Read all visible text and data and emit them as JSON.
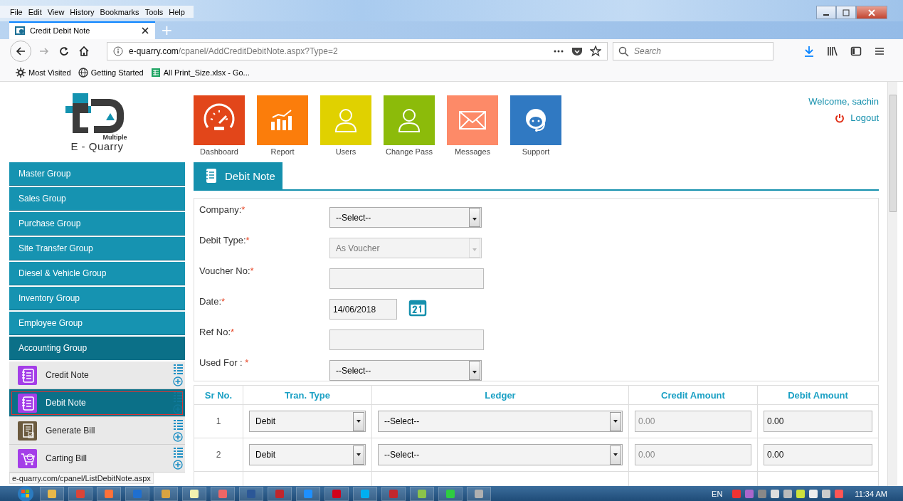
{
  "browser": {
    "menu": [
      "File",
      "Edit",
      "View",
      "History",
      "Bookmarks",
      "Tools",
      "Help"
    ],
    "tab": {
      "title": "Credit Debit Note",
      "selected": true
    },
    "new_tab": "+",
    "url": {
      "domain": "e-quarry.com",
      "path": "/cpanel/AddCreditDebitNote.aspx?Type=2"
    },
    "search": {
      "placeholder": "Search"
    },
    "bookmarks": [
      "Most Visited",
      "Getting Started",
      "All Print_Size.xlsx - Go..."
    ]
  },
  "header": {
    "logo": {
      "subtitle": "Multiple",
      "name": "E - Quarry"
    },
    "tiles": [
      {
        "label": "Dashboard",
        "color": "#e2461a"
      },
      {
        "label": "Report",
        "color": "#fb7d0b"
      },
      {
        "label": "Users",
        "color": "#e0d100"
      },
      {
        "label": "Change Pass",
        "color": "#8cbb0a"
      },
      {
        "label": "Messages",
        "color": "#fd8a68"
      },
      {
        "label": "Support",
        "color": "#3079c2"
      }
    ],
    "welcome": "Welcome, sachin",
    "logout": "Logout"
  },
  "sidebar": {
    "groups": [
      {
        "label": "Master Group",
        "expanded": false
      },
      {
        "label": "Sales Group",
        "expanded": false
      },
      {
        "label": "Purchase Group",
        "expanded": false
      },
      {
        "label": "Site Transfer Group",
        "expanded": false
      },
      {
        "label": "Diesel & Vehicle Group",
        "expanded": false
      },
      {
        "label": "Inventory Group",
        "expanded": false
      },
      {
        "label": "Employee Group",
        "expanded": false
      },
      {
        "label": "Accounting Group",
        "expanded": true
      }
    ],
    "items": [
      {
        "label": "Credit Note",
        "selected": false,
        "color": "#a43ee8"
      },
      {
        "label": "Debit Note",
        "selected": true,
        "color": "#a43ee8"
      },
      {
        "label": "Generate Bill",
        "selected": false,
        "color": "#6b5a3e"
      },
      {
        "label": "Carting Bill",
        "selected": false,
        "color": "#a43ee8"
      }
    ]
  },
  "section": {
    "title": "Debit Note"
  },
  "form": [
    {
      "label": "Company:",
      "required_mark": "*",
      "kind": "select",
      "value": "--Select--",
      "disabled": false
    },
    {
      "label": "Debit Type:",
      "required_mark": "*",
      "kind": "select",
      "value": "As Voucher",
      "disabled": true
    },
    {
      "label": "Voucher No:",
      "required_mark": "*",
      "kind": "input"
    },
    {
      "label": "Date:",
      "required_mark": "*",
      "kind": "date",
      "value": "14/06/2018"
    },
    {
      "label": "Ref No:",
      "required_mark": "*",
      "kind": "input"
    },
    {
      "label": "Used For : ",
      "required_mark": "*",
      "kind": "select",
      "value": "--Select--",
      "disabled": false
    }
  ],
  "table": {
    "columns": [
      "Sr No.",
      "Tran. Type",
      "Ledger",
      "Credit Amount",
      "Debit Amount"
    ],
    "rows": [
      {
        "sr": "1",
        "tran_type": "Debit",
        "ledger": "--Select--",
        "credit": {
          "value": "0.00",
          "disabled": true
        },
        "debit": {
          "value": "0.00",
          "disabled": false
        }
      },
      {
        "sr": "2",
        "tran_type": "Debit",
        "ledger": "--Select--",
        "credit": {
          "value": "0.00",
          "disabled": true
        },
        "debit": {
          "value": "0.00",
          "disabled": false
        }
      }
    ]
  },
  "status_url": "e-quarry.com/cpanel/ListDebitNote.aspx",
  "taskbar": {
    "language": "EN",
    "time": "11:34 AM"
  }
}
